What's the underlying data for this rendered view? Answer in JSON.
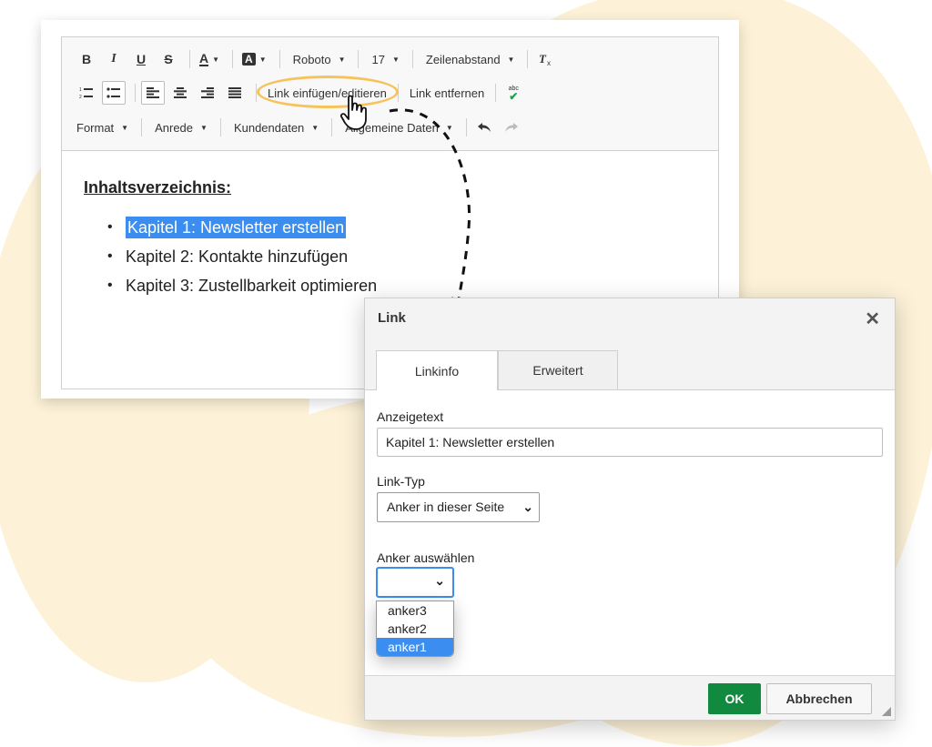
{
  "editor": {
    "toolbar": {
      "bold_label": "B",
      "italic_label": "I",
      "underline_label": "U",
      "strike_label": "S",
      "text_color_label": "A",
      "bg_color_label": "A",
      "font_family": "Roboto",
      "font_size": "17",
      "line_height": "Zeilenabstand",
      "link_insert_label": "Link einfügen/editieren",
      "link_remove_label": "Link entfernen",
      "spell_label": "abc",
      "format_label": "Format",
      "salutation_label": "Anrede",
      "customer_data_label": "Kundendaten",
      "general_data_label": "Allgemeine Daten"
    },
    "content": {
      "heading": "Inhaltsverzeichnis:",
      "items": [
        "Kapitel 1: Newsletter erstellen",
        "Kapitel 2: Kontakte hinzufügen",
        "Kapitel 3: Zustellbarkeit optimieren"
      ]
    }
  },
  "dialog": {
    "title": "Link",
    "close_glyph": "✕",
    "tabs": [
      "Linkinfo",
      "Erweitert"
    ],
    "display_text_label": "Anzeigetext",
    "display_text_value": "Kapitel 1: Newsletter erstellen",
    "link_type_label": "Link-Typ",
    "link_type_value": "Anker in dieser Seite",
    "anchor_label": "Anker auswählen",
    "anchor_options": [
      "anker3",
      "anker2",
      "anker1"
    ],
    "anchor_selected": "anker1",
    "ok_label": "OK",
    "cancel_label": "Abbrechen"
  },
  "colors": {
    "accent": "#3b8ef0",
    "ok_green": "#118a3f",
    "highlight": "#f6c35b",
    "background_blob": "#fdf2d8"
  }
}
